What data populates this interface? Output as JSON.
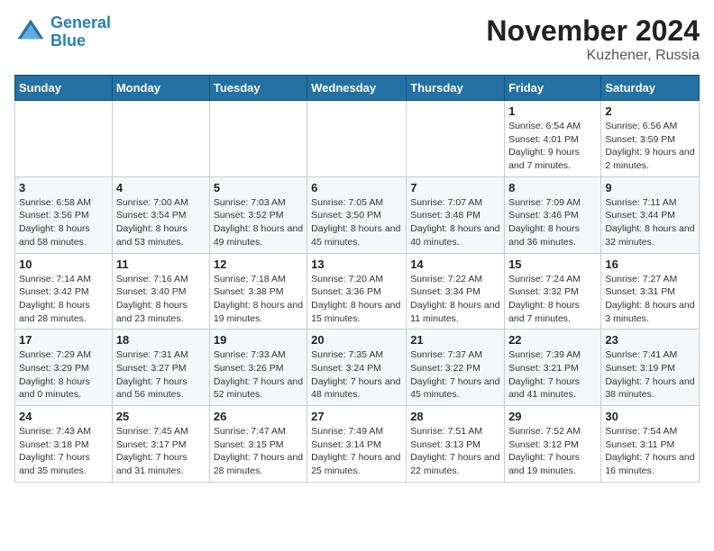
{
  "logo": {
    "line1": "General",
    "line2": "Blue"
  },
  "title": "November 2024",
  "location": "Kuzhener, Russia",
  "days_of_week": [
    "Sunday",
    "Monday",
    "Tuesday",
    "Wednesday",
    "Thursday",
    "Friday",
    "Saturday"
  ],
  "weeks": [
    [
      {
        "day": "",
        "info": ""
      },
      {
        "day": "",
        "info": ""
      },
      {
        "day": "",
        "info": ""
      },
      {
        "day": "",
        "info": ""
      },
      {
        "day": "",
        "info": ""
      },
      {
        "day": "1",
        "info": "Sunrise: 6:54 AM\nSunset: 4:01 PM\nDaylight: 9 hours and 7 minutes."
      },
      {
        "day": "2",
        "info": "Sunrise: 6:56 AM\nSunset: 3:59 PM\nDaylight: 9 hours and 2 minutes."
      }
    ],
    [
      {
        "day": "3",
        "info": "Sunrise: 6:58 AM\nSunset: 3:56 PM\nDaylight: 8 hours and 58 minutes."
      },
      {
        "day": "4",
        "info": "Sunrise: 7:00 AM\nSunset: 3:54 PM\nDaylight: 8 hours and 53 minutes."
      },
      {
        "day": "5",
        "info": "Sunrise: 7:03 AM\nSunset: 3:52 PM\nDaylight: 8 hours and 49 minutes."
      },
      {
        "day": "6",
        "info": "Sunrise: 7:05 AM\nSunset: 3:50 PM\nDaylight: 8 hours and 45 minutes."
      },
      {
        "day": "7",
        "info": "Sunrise: 7:07 AM\nSunset: 3:48 PM\nDaylight: 8 hours and 40 minutes."
      },
      {
        "day": "8",
        "info": "Sunrise: 7:09 AM\nSunset: 3:46 PM\nDaylight: 8 hours and 36 minutes."
      },
      {
        "day": "9",
        "info": "Sunrise: 7:11 AM\nSunset: 3:44 PM\nDaylight: 8 hours and 32 minutes."
      }
    ],
    [
      {
        "day": "10",
        "info": "Sunrise: 7:14 AM\nSunset: 3:42 PM\nDaylight: 8 hours and 28 minutes."
      },
      {
        "day": "11",
        "info": "Sunrise: 7:16 AM\nSunset: 3:40 PM\nDaylight: 8 hours and 23 minutes."
      },
      {
        "day": "12",
        "info": "Sunrise: 7:18 AM\nSunset: 3:38 PM\nDaylight: 8 hours and 19 minutes."
      },
      {
        "day": "13",
        "info": "Sunrise: 7:20 AM\nSunset: 3:36 PM\nDaylight: 8 hours and 15 minutes."
      },
      {
        "day": "14",
        "info": "Sunrise: 7:22 AM\nSunset: 3:34 PM\nDaylight: 8 hours and 11 minutes."
      },
      {
        "day": "15",
        "info": "Sunrise: 7:24 AM\nSunset: 3:32 PM\nDaylight: 8 hours and 7 minutes."
      },
      {
        "day": "16",
        "info": "Sunrise: 7:27 AM\nSunset: 3:31 PM\nDaylight: 8 hours and 3 minutes."
      }
    ],
    [
      {
        "day": "17",
        "info": "Sunrise: 7:29 AM\nSunset: 3:29 PM\nDaylight: 8 hours and 0 minutes."
      },
      {
        "day": "18",
        "info": "Sunrise: 7:31 AM\nSunset: 3:27 PM\nDaylight: 7 hours and 56 minutes."
      },
      {
        "day": "19",
        "info": "Sunrise: 7:33 AM\nSunset: 3:26 PM\nDaylight: 7 hours and 52 minutes."
      },
      {
        "day": "20",
        "info": "Sunrise: 7:35 AM\nSunset: 3:24 PM\nDaylight: 7 hours and 48 minutes."
      },
      {
        "day": "21",
        "info": "Sunrise: 7:37 AM\nSunset: 3:22 PM\nDaylight: 7 hours and 45 minutes."
      },
      {
        "day": "22",
        "info": "Sunrise: 7:39 AM\nSunset: 3:21 PM\nDaylight: 7 hours and 41 minutes."
      },
      {
        "day": "23",
        "info": "Sunrise: 7:41 AM\nSunset: 3:19 PM\nDaylight: 7 hours and 38 minutes."
      }
    ],
    [
      {
        "day": "24",
        "info": "Sunrise: 7:43 AM\nSunset: 3:18 PM\nDaylight: 7 hours and 35 minutes."
      },
      {
        "day": "25",
        "info": "Sunrise: 7:45 AM\nSunset: 3:17 PM\nDaylight: 7 hours and 31 minutes."
      },
      {
        "day": "26",
        "info": "Sunrise: 7:47 AM\nSunset: 3:15 PM\nDaylight: 7 hours and 28 minutes."
      },
      {
        "day": "27",
        "info": "Sunrise: 7:49 AM\nSunset: 3:14 PM\nDaylight: 7 hours and 25 minutes."
      },
      {
        "day": "28",
        "info": "Sunrise: 7:51 AM\nSunset: 3:13 PM\nDaylight: 7 hours and 22 minutes."
      },
      {
        "day": "29",
        "info": "Sunrise: 7:52 AM\nSunset: 3:12 PM\nDaylight: 7 hours and 19 minutes."
      },
      {
        "day": "30",
        "info": "Sunrise: 7:54 AM\nSunset: 3:11 PM\nDaylight: 7 hours and 16 minutes."
      }
    ]
  ]
}
